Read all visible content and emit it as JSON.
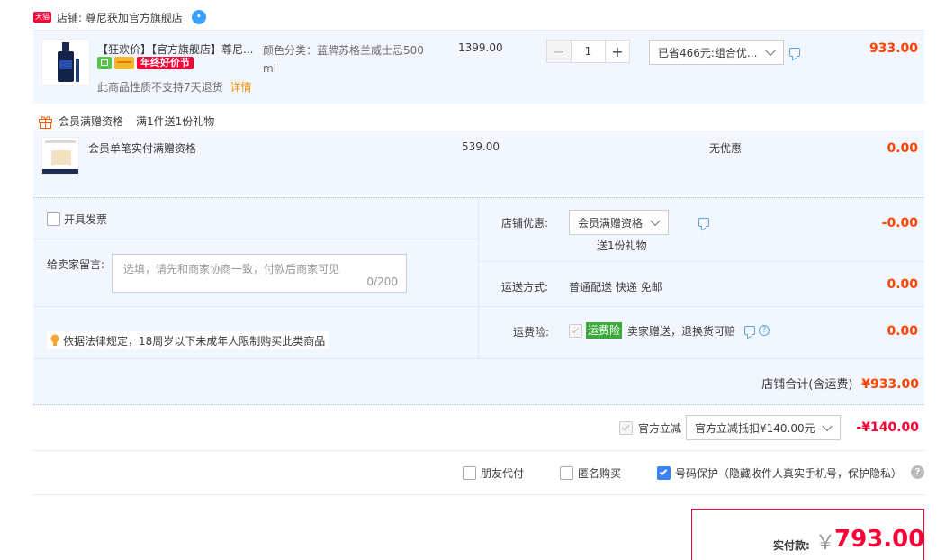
{
  "store": {
    "badge": "天猫",
    "label": "店铺: 尊尼获加官方旗舰店",
    "wangwang": "ꔷ"
  },
  "item": {
    "title": "【狂欢价】【官方旗舰店】尊尼...",
    "promo_badge": "年终好价节",
    "note": "此商品性质不支持7天退货",
    "detail_link": "详情",
    "sku_line1": "颜色分类：蓝牌苏格兰威士忌500",
    "sku_line2": "ml",
    "unit_price": "1399.00",
    "qty": "1",
    "minus": "−",
    "plus": "+",
    "discount_select": "已省466元:组合优...",
    "subtotal": "933.00"
  },
  "gift": {
    "header_label": "会员满赠资格",
    "header_rule": "满1件送1份礼物",
    "item_name": "会员单笔实付满赠资格",
    "unit_price": "539.00",
    "discount": "无优惠",
    "subtotal": "0.00"
  },
  "invoice": {
    "label": "开具发票"
  },
  "message": {
    "label": "给卖家留言:",
    "placeholder": "选填，请先和商家协商一致，付款后商家可见",
    "counter": "0/200"
  },
  "legal_note": "依据法律规定，18周岁以下未成年人限制购买此类商品",
  "store_discount": {
    "label": "店铺优惠:",
    "select": "会员满赠资格",
    "sub": "送1份礼物",
    "amount": "-0.00"
  },
  "shipping": {
    "label": "运送方式:",
    "value": "普通配送 快递 免邮",
    "amount": "0.00"
  },
  "insurance": {
    "label": "运费险:",
    "badge": "运费险",
    "text": "卖家赠送，退换货可赔",
    "amount": "0.00"
  },
  "store_total": {
    "label": "店铺合计(含运费)",
    "amount": "¥933.00"
  },
  "official_discount": {
    "label": "官方立减",
    "select": "官方立减抵扣¥140.00元",
    "amount": "-¥140.00"
  },
  "options": {
    "friend_pay": "朋友代付",
    "anonymous": "匿名购买",
    "privacy": "号码保护（隐藏收件人真实手机号，保护隐私）",
    "help": "?"
  },
  "payable": {
    "label": "实付款:",
    "currency": "￥",
    "amount": "793.00"
  },
  "colors": {
    "accent_red": "#f40",
    "price_red": "#ff0036",
    "row_bg": "#f2f7ff",
    "tmall_red": "#ff0036",
    "check_blue": "#3b82f6"
  }
}
